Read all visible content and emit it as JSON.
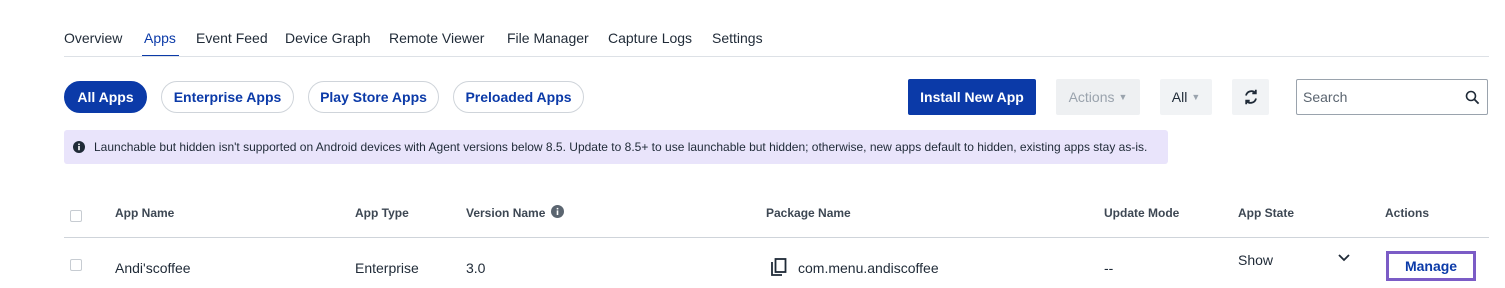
{
  "tabs": [
    {
      "label": "Overview"
    },
    {
      "label": "Apps"
    },
    {
      "label": "Event Feed"
    },
    {
      "label": "Device Graph"
    },
    {
      "label": "Remote Viewer"
    },
    {
      "label": "File Manager"
    },
    {
      "label": "Capture Logs"
    },
    {
      "label": "Settings"
    }
  ],
  "active_tab": "Apps",
  "filters": [
    {
      "label": "All Apps"
    },
    {
      "label": "Enterprise Apps"
    },
    {
      "label": "Play Store Apps"
    },
    {
      "label": "Preloaded Apps"
    }
  ],
  "active_filter": "All Apps",
  "toolbar": {
    "install_label": "Install New App",
    "actions_label": "Actions",
    "state_filter_value": "All",
    "refresh_icon": "refresh-icon",
    "search_placeholder": "Search",
    "search_icon": "search-icon"
  },
  "banner": {
    "icon": "info-icon",
    "text": "Launchable but hidden isn't supported on Android devices with Agent versions below 8.5. Update to 8.5+ to use launchable but hidden; otherwise, new apps default to hidden, existing apps stay as-is."
  },
  "table": {
    "columns": {
      "app_name": "App Name",
      "app_type": "App Type",
      "version_name": "Version Name",
      "package_name": "Package Name",
      "update_mode": "Update Mode",
      "app_state": "App State",
      "actions": "Actions"
    },
    "rows": [
      {
        "app_name": "Andi'scoffee",
        "app_type": "Enterprise",
        "version_name": "3.0",
        "package_name": "com.menu.andiscoffee",
        "update_mode": "--",
        "app_state": "Show",
        "action_label": "Manage"
      }
    ]
  },
  "colors": {
    "brand": "#0b3aa8",
    "banner_bg": "#e9e4fb",
    "highlight": "#7b5cc6"
  }
}
